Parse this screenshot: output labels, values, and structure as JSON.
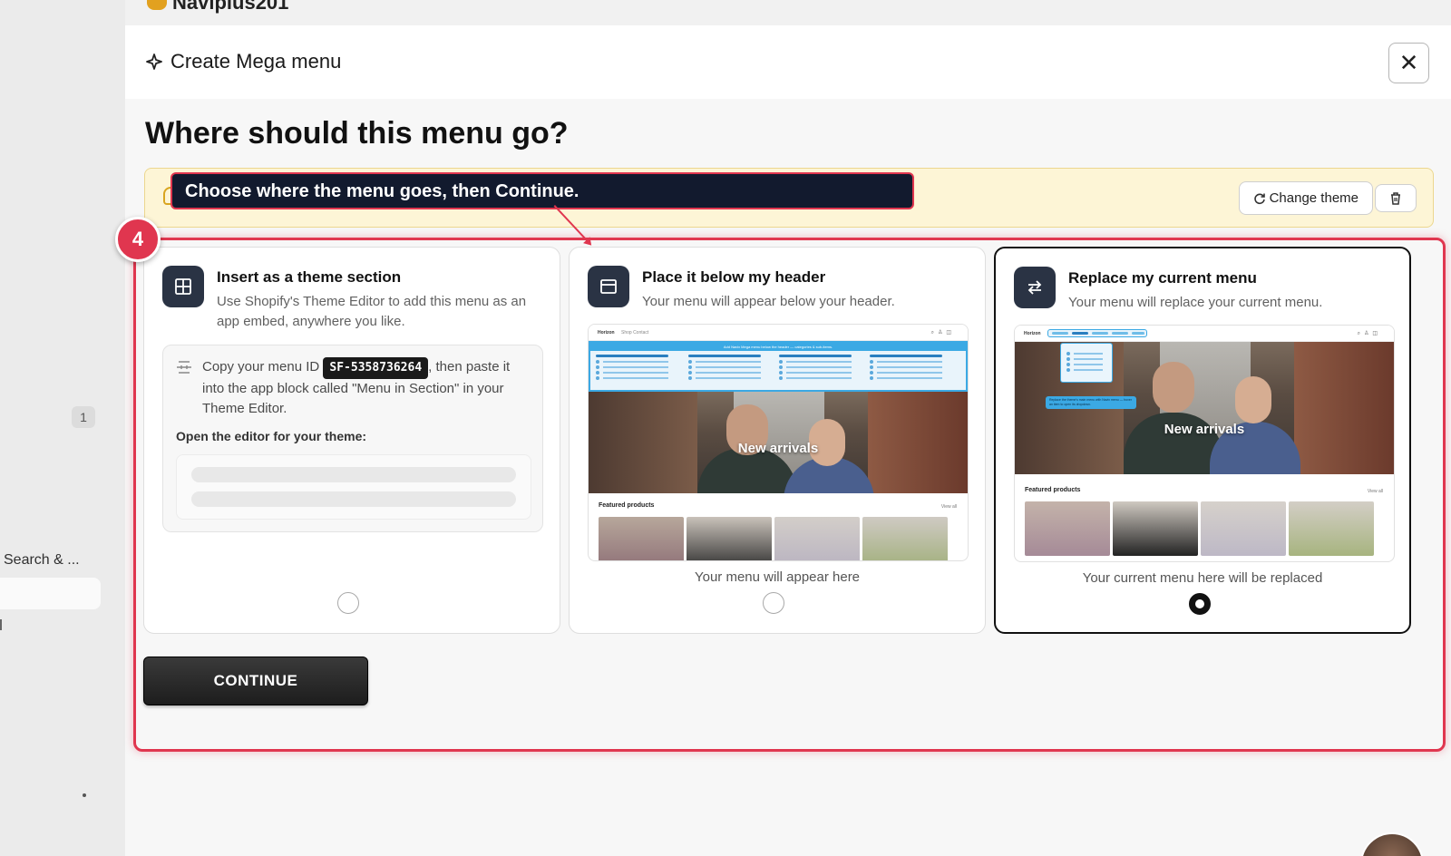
{
  "app": {
    "title": "Naviplus201"
  },
  "sidebar": {
    "badge_count": "1",
    "search_label": "Search & ..."
  },
  "modal": {
    "title": "Create Mega menu",
    "close_label": "✕"
  },
  "page": {
    "question": "Where should this menu go?"
  },
  "banner": {
    "change_theme_label": "Change theme"
  },
  "tour": {
    "step_number": "4",
    "tooltip": "Choose where the menu goes, then Continue.",
    "highlight_color": "#e0364f"
  },
  "options": [
    {
      "title": "Insert as a theme section",
      "description": "Use Shopify's Theme Editor to add this menu as an app embed, anywhere you like.",
      "icon": "grid-icon",
      "copy_text_before": "Copy your menu ID",
      "menu_id": "SF-5358736264",
      "copy_text_after": ", then paste it into the app block called \"Menu in Section\" in your Theme Editor.",
      "editor_label": "Open the editor for your theme:",
      "selected": false
    },
    {
      "title": "Place it below my header",
      "description": "Your menu will appear below your header.",
      "icon": "window-icon",
      "caption": "Your menu will appear here",
      "preview": {
        "logo": "Horizon",
        "nav_links": "Shop   Contact",
        "mega_banner": "Add Navix Mega menu below the header — categories & sub-items.",
        "hero_text": "New arrivals",
        "featured": "Featured products",
        "view_all": "View all"
      },
      "selected": false
    },
    {
      "title": "Replace my current menu",
      "description": "Your menu will replace your current menu.",
      "icon": "swap-icon",
      "caption": "Your current menu here will be replaced",
      "preview": {
        "logo": "Horizon",
        "callout": "Replace the theme's main menu with Navix menu — hover an item to open its dropdown.",
        "hero_text": "New arrivals",
        "featured": "Featured products",
        "view_all": "View all"
      },
      "selected": true
    }
  ],
  "actions": {
    "continue_label": "CONTINUE"
  },
  "colors": {
    "accent_dark": "#2a3344",
    "preview_blue": "#3ba9e4",
    "banner_bg": "#fdf5d6"
  }
}
